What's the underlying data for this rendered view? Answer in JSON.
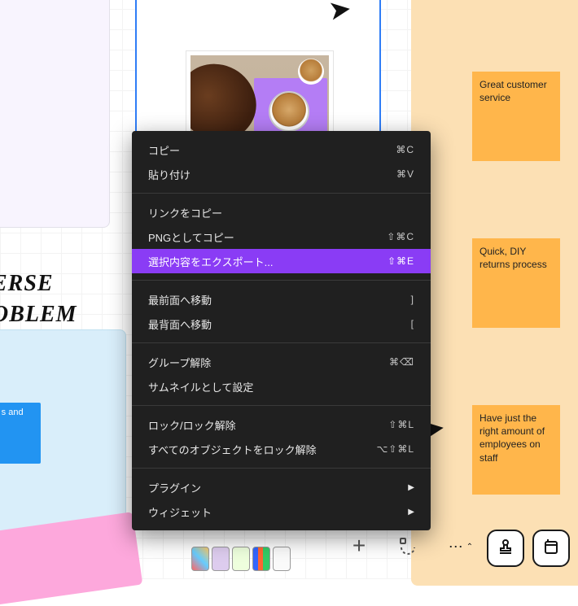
{
  "handwriting": {
    "line1": "ERSE",
    "line2": "OBLEM"
  },
  "blue_note": "rrent s and ones",
  "sticky_notes": [
    "Great customer service",
    "Quick, DIY returns process",
    "Have just the right amount of employees on staff"
  ],
  "context_menu": {
    "group1": [
      {
        "label": "コピー",
        "shortcut": "⌘C"
      },
      {
        "label": "貼り付け",
        "shortcut": "⌘V"
      }
    ],
    "group2": [
      {
        "label": "リンクをコピー",
        "shortcut": ""
      },
      {
        "label": "PNGとしてコピー",
        "shortcut": "⇧⌘C"
      },
      {
        "label": "選択内容をエクスポート...",
        "shortcut": "⇧⌘E",
        "highlight": true
      }
    ],
    "group3": [
      {
        "label": "最前面へ移動",
        "shortcut": "]"
      },
      {
        "label": "最背面へ移動",
        "shortcut": "["
      }
    ],
    "group4": [
      {
        "label": "グループ解除",
        "shortcut": "⌘⌫"
      },
      {
        "label": "サムネイルとして設定",
        "shortcut": ""
      }
    ],
    "group5": [
      {
        "label": "ロック/ロック解除",
        "shortcut": "⇧⌘L"
      },
      {
        "label": "すべてのオブジェクトをロック解除",
        "shortcut": "⌥⇧⌘L"
      }
    ],
    "group6": [
      {
        "label": "プラグイン",
        "submenu": true
      },
      {
        "label": "ウィジェット",
        "submenu": true
      }
    ]
  },
  "toolbar": {
    "more": "⋯",
    "chevron": "⌃"
  }
}
